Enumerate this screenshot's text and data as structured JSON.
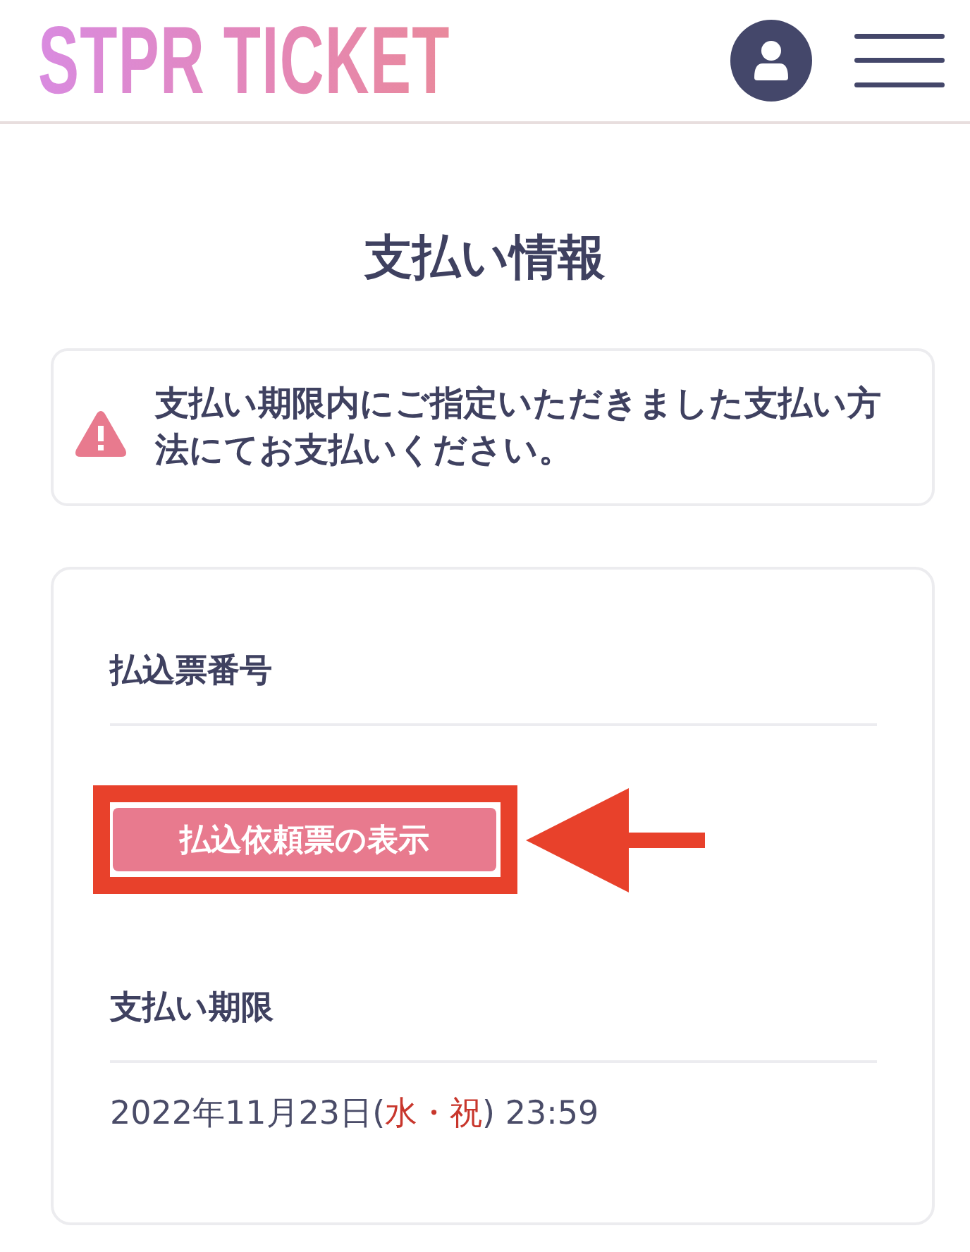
{
  "header": {
    "logo": "STPR TICKET"
  },
  "page_title": "支払い情報",
  "alert": {
    "message": "支払い期限内にご指定いただきました支払い方法にてお支払いください。"
  },
  "payment_card": {
    "slip_number": {
      "label": "払込票番号"
    },
    "slip_button": {
      "label": "払込依頼票の表示"
    },
    "deadline": {
      "label": "支払い期限",
      "value_parts": [
        {
          "text": "2022年11月23日(",
          "highlight": false
        },
        {
          "text": "水・祝",
          "highlight": true
        },
        {
          "text": ") 23:59",
          "highlight": false
        }
      ]
    }
  },
  "callout": {
    "kind": "frame-and-arrow"
  }
}
